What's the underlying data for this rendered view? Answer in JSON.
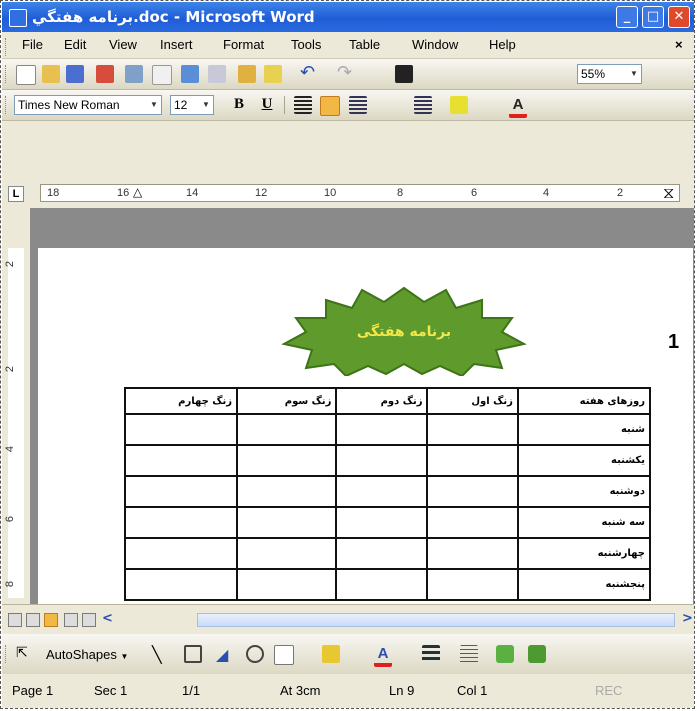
{
  "window": {
    "title": "برنامه هفتگي.doc - Microsoft Word",
    "controls": {
      "minimize": "_",
      "maximize": "□",
      "close": "✕"
    }
  },
  "menu": {
    "items": [
      {
        "label": "File"
      },
      {
        "label": "Edit"
      },
      {
        "label": "View"
      },
      {
        "label": "Insert"
      },
      {
        "label": "Format"
      },
      {
        "label": "Tools"
      },
      {
        "label": "Table"
      },
      {
        "label": "Window"
      },
      {
        "label": "Help"
      }
    ],
    "close_glyph": "×"
  },
  "standard_toolbar": {
    "zoom": "55%"
  },
  "formatting_toolbar": {
    "font": "Times New Roman",
    "size": "12",
    "bold": "B",
    "underline": "U",
    "font_color_label": "A"
  },
  "ruler": {
    "tab_selector": "L",
    "marks": [
      "18",
      "16",
      "14",
      "12",
      "10",
      "8",
      "6",
      "4",
      "2"
    ],
    "vertical_marks": [
      "2",
      "2",
      "4",
      "6",
      "8"
    ]
  },
  "document": {
    "wordart_text": "برنامه هفتگی",
    "number_label": "1",
    "table": {
      "headers": [
        "روزهای هفته",
        "زنگ اول",
        "زنگ دوم",
        "زنگ سوم",
        "زنگ چهارم"
      ],
      "rows": [
        "شنبه",
        "یکشنبه",
        "دوشنبه",
        "سه شنبه",
        "چهارشنبه",
        "پنجشنبه"
      ]
    }
  },
  "drawing_toolbar": {
    "autoshapes": "AutoShapes",
    "font_color_label": "A"
  },
  "status_bar": {
    "page": "Page 1",
    "section": "Sec 1",
    "pages": "1/1",
    "at": "At 3cm",
    "line": "Ln 9",
    "col": "Col 1",
    "rec": "REC"
  },
  "colors": {
    "titlebar": "#2a6ae0",
    "close_button": "#e04a2a",
    "wordart_fill": "#5e9a2c",
    "wordart_text": "#f2e84a"
  }
}
